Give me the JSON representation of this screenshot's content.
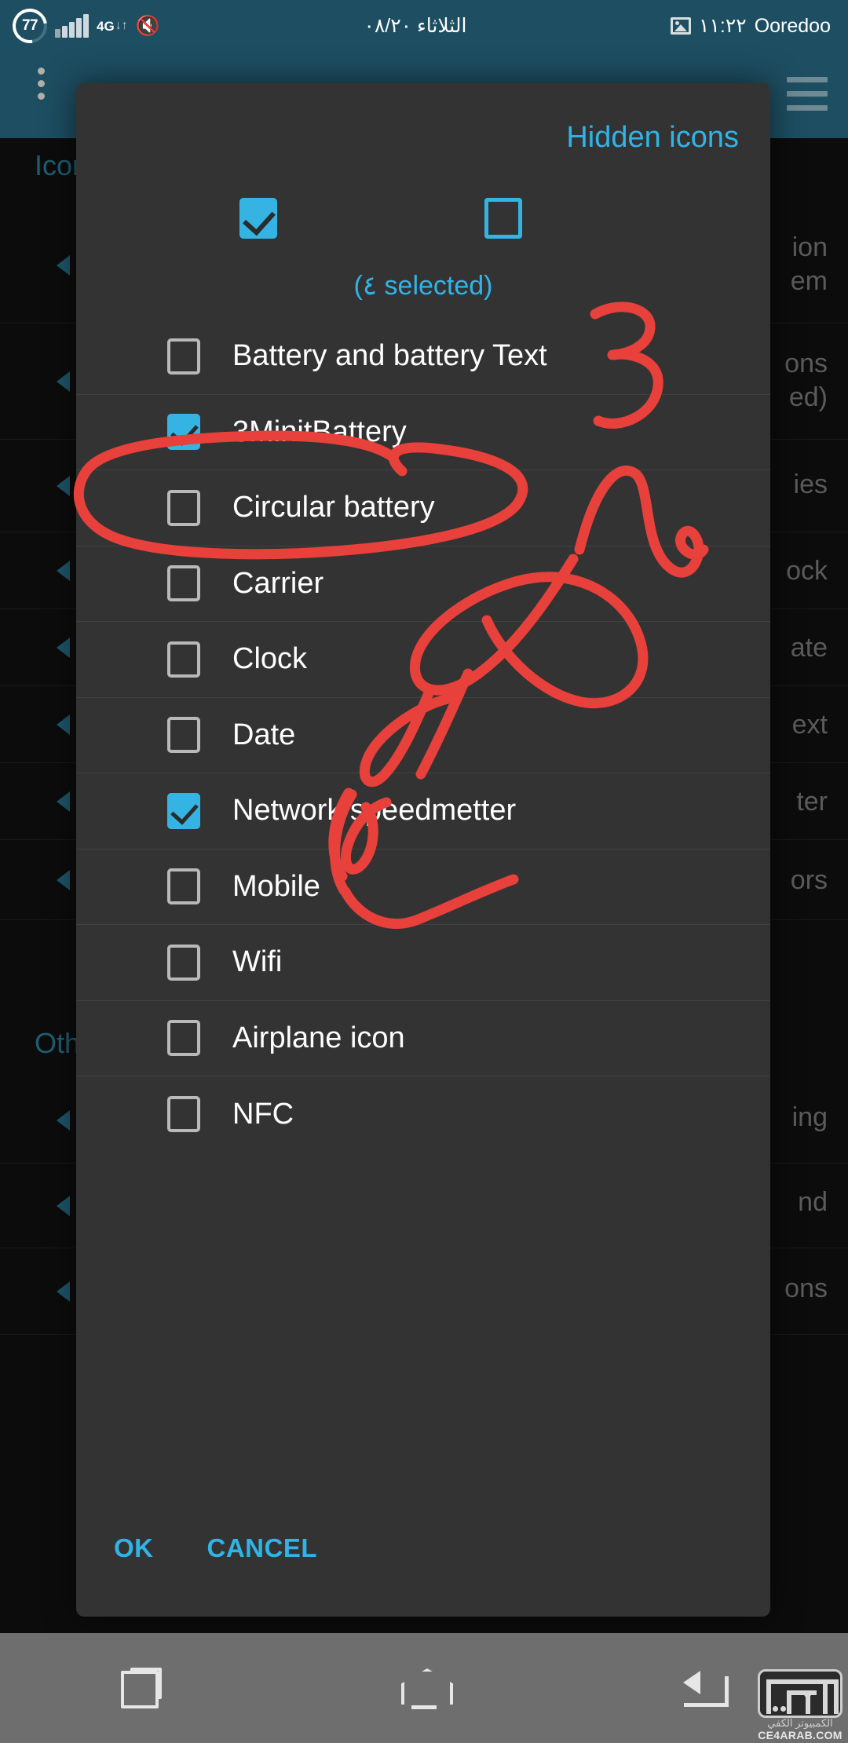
{
  "status_bar": {
    "battery_percent": "77",
    "network_type": "4G",
    "date": "الثلاثاء ٠٨/٢٠",
    "time": "١١:٢٢",
    "carrier": "Ooredoo",
    "icons": [
      "circular-battery-icon",
      "signal-bars-icon",
      "4g-data-icon",
      "vibrate-mute-icon",
      "screenshot-image-icon"
    ],
    "background": "#1d4e61"
  },
  "app": {
    "toolbar": {
      "overflow_icon": "overflow-menu-icon",
      "drawer_icon": "hamburger-menu-icon"
    },
    "sections": [
      {
        "title": "Icon"
      },
      {
        "title": "Othe"
      }
    ],
    "rows": [
      {
        "text": "ion",
        "sub": "em"
      },
      {
        "text": "ons",
        "sub": "ed)"
      },
      {
        "text": "ies",
        "sub": ""
      },
      {
        "text": "ock",
        "sub": ""
      },
      {
        "text": "ate",
        "sub": ""
      },
      {
        "text": "ext",
        "sub": ""
      },
      {
        "text": "ter",
        "sub": ""
      },
      {
        "text": "ors",
        "sub": ""
      },
      {
        "text": "ing",
        "sub": ""
      },
      {
        "text": "nd",
        "sub": ""
      },
      {
        "text": "ons",
        "sub": ""
      }
    ]
  },
  "dialog": {
    "title": "Hidden icons",
    "select_all_checked": true,
    "hidden_all_checked": false,
    "selected_count_label": "(٤ selected)",
    "accent_color": "#30b4e8",
    "surface_color": "#333333",
    "items": [
      {
        "label": "Battery and battery Text",
        "checked": false
      },
      {
        "label": "3MinitBattery",
        "checked": true
      },
      {
        "label": "Circular battery",
        "checked": false
      },
      {
        "label": "Carrier",
        "checked": false
      },
      {
        "label": "Clock",
        "checked": false
      },
      {
        "label": "Date",
        "checked": false
      },
      {
        "label": "Network speedmetter",
        "checked": true
      },
      {
        "label": "Mobile",
        "checked": false
      },
      {
        "label": "Wifi",
        "checked": false
      },
      {
        "label": "Airplane icon",
        "checked": false
      },
      {
        "label": "NFC",
        "checked": false
      }
    ],
    "buttons": {
      "ok": "OK",
      "cancel": "CANCEL"
    }
  },
  "annotations": {
    "color": "#e8403a",
    "marks": [
      "handwritten-digit-3",
      "ellipse-around-3minitbattery",
      "arabic-handwriting-scribble"
    ]
  },
  "nav_bar": {
    "background": "#6e6e6e",
    "buttons": [
      "recent-apps",
      "home",
      "back"
    ]
  },
  "watermark": {
    "arabic_text": "الكمبيوتر الكفي",
    "url": "CE4ARAB.COM"
  }
}
